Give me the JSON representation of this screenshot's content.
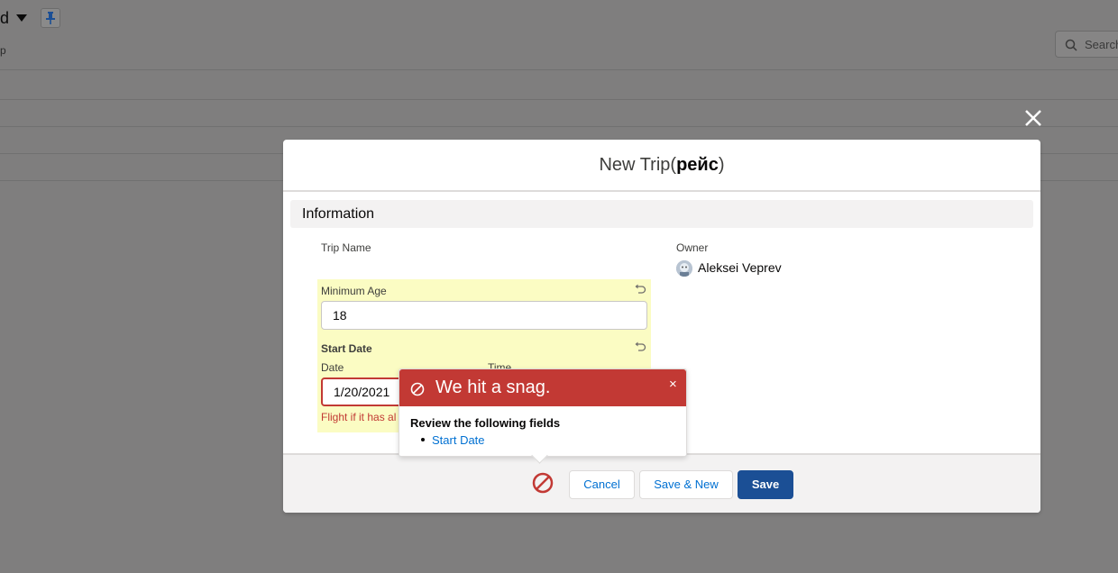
{
  "background": {
    "title_fragment": "d",
    "subtitle_fragment": "p",
    "search_placeholder": "Search"
  },
  "modal": {
    "title_plain": "New Trip(",
    "title_bold": "рейс",
    "title_close": ")",
    "section_title": "Information",
    "fields": {
      "trip_name_label": "Trip Name",
      "owner_label": "Owner",
      "owner_name": "Aleksei Veprev",
      "min_age_label": "Minimum Age",
      "min_age_value": "18",
      "start_date_label": "Start Date",
      "date_label": "Date",
      "time_label": "Time",
      "date_value": "1/20/2021",
      "date_error": "Flight if it has al"
    },
    "footer": {
      "cancel": "Cancel",
      "save_new": "Save & New",
      "save": "Save"
    }
  },
  "error_popover": {
    "title": "We hit a snag.",
    "close": "×",
    "review_heading": "Review the following fields",
    "fields": [
      "Start Date"
    ]
  },
  "colors": {
    "brand": "#1b4f95",
    "error": "#c23934",
    "highlight": "#fbfcc3",
    "link": "#0070d2"
  }
}
